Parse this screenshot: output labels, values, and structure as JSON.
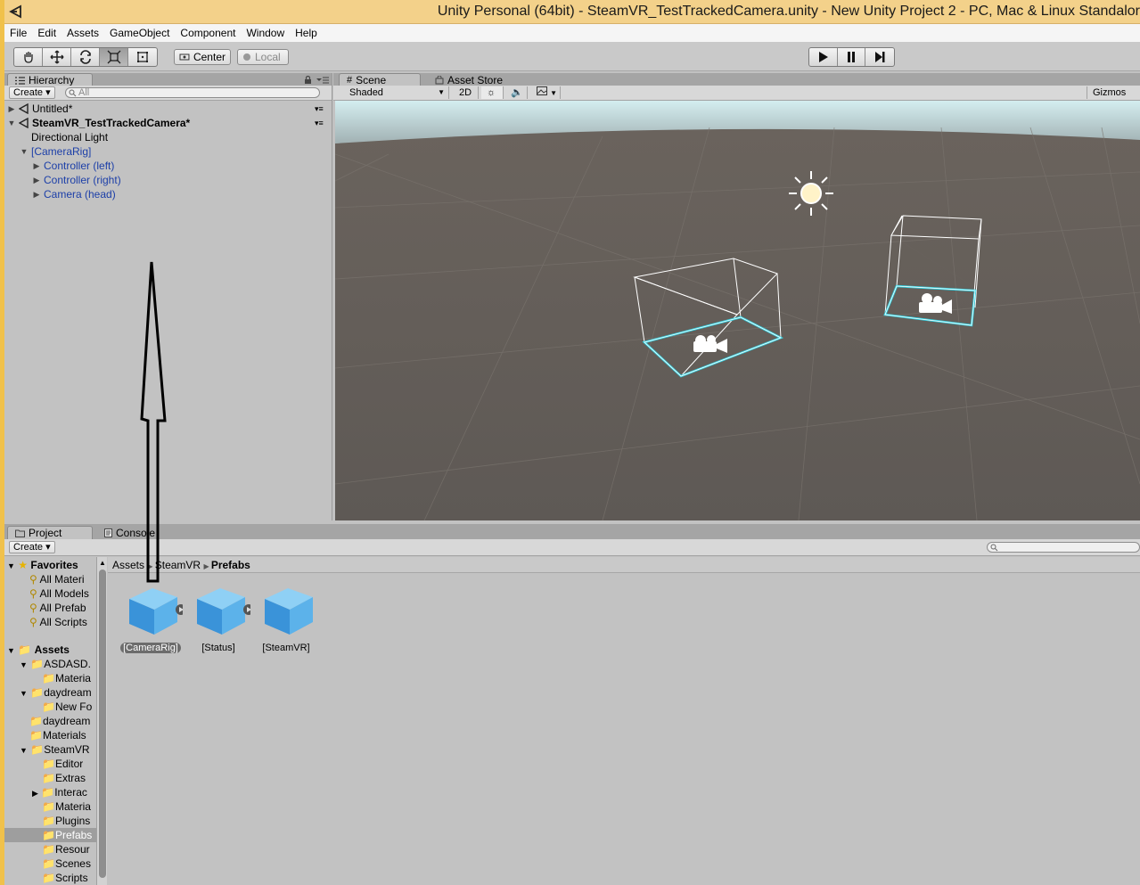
{
  "window": {
    "title": "Unity Personal (64bit) - SteamVR_TestTrackedCamera.unity - New Unity Project 2 - PC, Mac & Linux Standalor"
  },
  "menubar": [
    "File",
    "Edit",
    "Assets",
    "GameObject",
    "Component",
    "Window",
    "Help"
  ],
  "toolbar": {
    "pivot_label": "Center",
    "space_label": "Local"
  },
  "hierarchy": {
    "tab_label": "Hierarchy",
    "create_label": "Create",
    "search_placeholder": "All",
    "items": [
      {
        "label": "Untitled*"
      },
      {
        "label": "SteamVR_TestTrackedCamera*"
      },
      {
        "label": "Directional Light"
      },
      {
        "label": "[CameraRig]"
      },
      {
        "label": "Controller (left)"
      },
      {
        "label": "Controller (right)"
      },
      {
        "label": "Camera (head)"
      }
    ]
  },
  "scene": {
    "tabs": [
      "Scene",
      "Asset Store"
    ],
    "shading_mode": "Shaded",
    "mode_2d_label": "2D",
    "gizmos_label": "Gizmos"
  },
  "project": {
    "tabs": [
      "Project",
      "Console"
    ],
    "create_label": "Create",
    "favorites_label": "Favorites",
    "favorites": [
      "All Materi",
      "All Models",
      "All Prefab",
      "All Scripts"
    ],
    "assets_label": "Assets",
    "folders": [
      "ASDASD.",
      "Materia",
      "daydream",
      "New Fo",
      "daydream",
      "Materials",
      "SteamVR",
      "Editor",
      "Extras",
      "Interac",
      "Materia",
      "Plugins",
      "Prefabs",
      "Resour",
      "Scenes",
      "Scripts"
    ],
    "breadcrumb": [
      "Assets",
      "SteamVR",
      "Prefabs"
    ],
    "assets": [
      {
        "label": "[CameraRig]",
        "selected": true
      },
      {
        "label": "[Status]",
        "selected": false
      },
      {
        "label": "[SteamVR]",
        "selected": false
      }
    ]
  },
  "colors": {
    "title_bar": "#f3d18a",
    "panel_bg": "#c2c2c2",
    "tree_blue": "#1c3fa8",
    "selection_cyan": "#34d2e2"
  }
}
